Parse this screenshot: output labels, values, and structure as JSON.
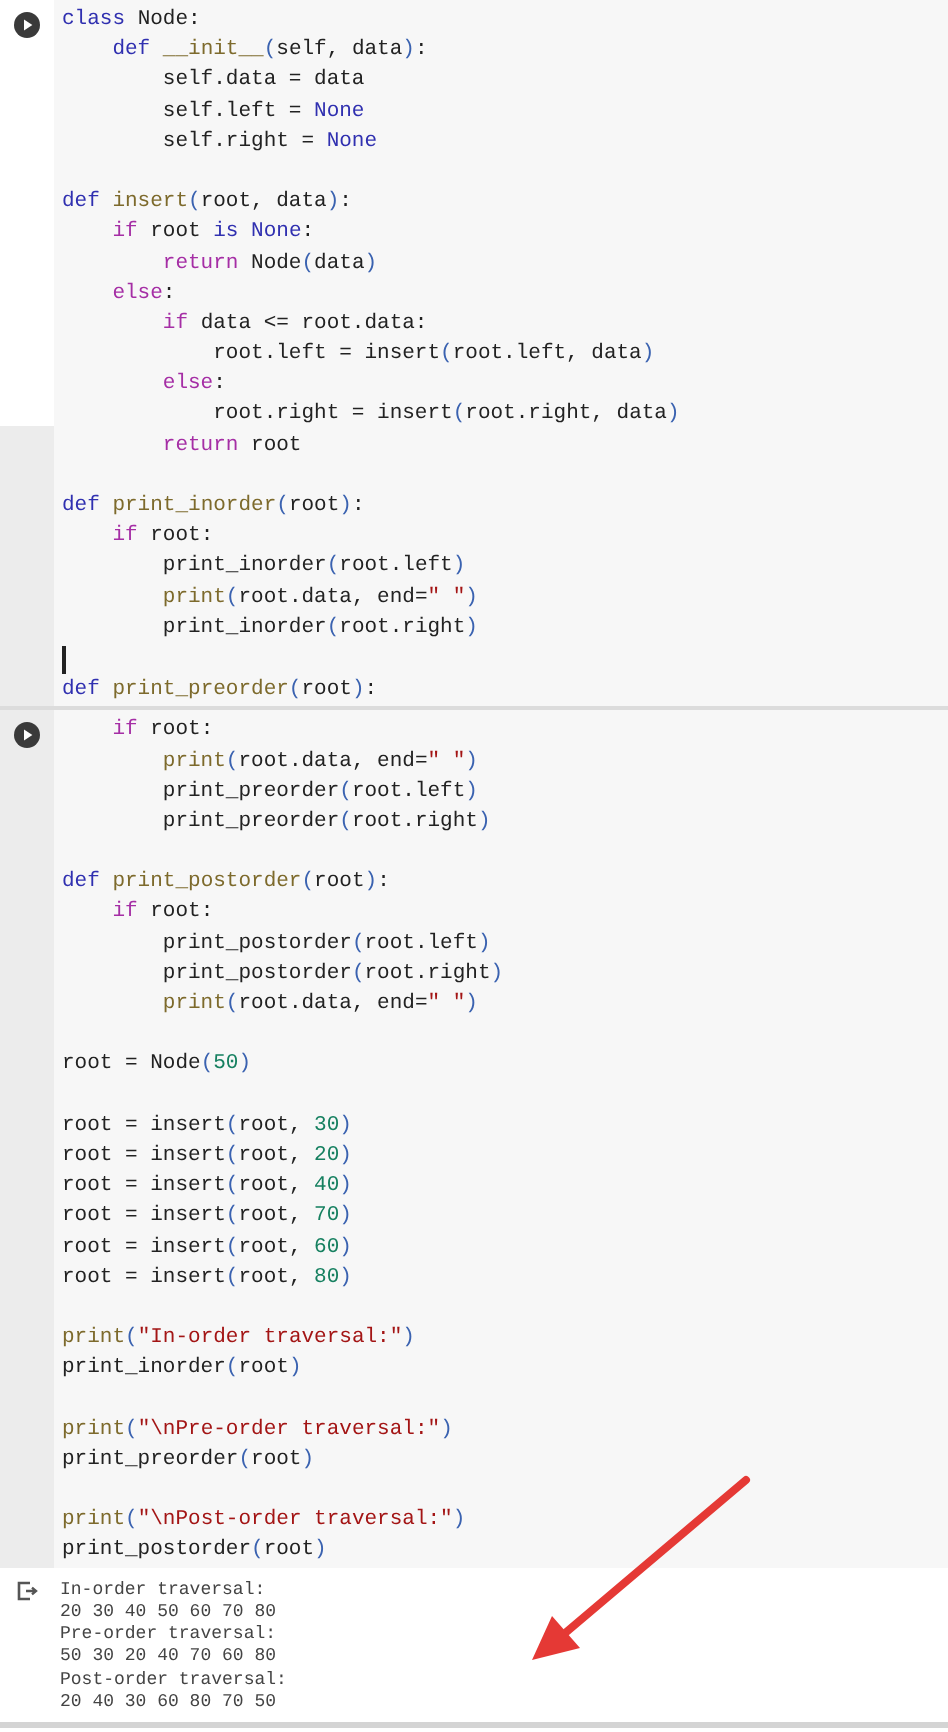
{
  "cells": [
    {
      "lines": [
        {
          "t": [
            {
              "text": "class",
              "kind": "kw"
            },
            {
              "text": " Node:",
              "kind": "txt"
            }
          ]
        },
        {
          "t": [
            {
              "text": "    def",
              "kind": "kw"
            },
            {
              "text": " __init__",
              "kind": "fn"
            },
            {
              "text": "(",
              "kind": "br"
            },
            {
              "text": "self, data",
              "kind": "txt"
            },
            {
              "text": ")",
              "kind": "br"
            },
            {
              "text": ":",
              "kind": "txt"
            }
          ]
        },
        {
          "t": [
            {
              "text": "        self.data = data",
              "kind": "txt"
            }
          ]
        },
        {
          "t": [
            {
              "text": "        self.left = ",
              "kind": "txt"
            },
            {
              "text": "None",
              "kind": "kw"
            }
          ]
        },
        {
          "t": [
            {
              "text": "        self.right = ",
              "kind": "txt"
            },
            {
              "text": "None",
              "kind": "kw"
            }
          ]
        },
        {
          "t": [
            {
              "text": "def",
              "kind": "kw"
            },
            {
              "text": " insert",
              "kind": "fn"
            },
            {
              "text": "(",
              "kind": "br"
            },
            {
              "text": "root, data",
              "kind": "txt"
            },
            {
              "text": ")",
              "kind": "br"
            },
            {
              "text": ":",
              "kind": "txt"
            }
          ],
          "space_before": true
        },
        {
          "t": [
            {
              "text": "    if",
              "kind": "ctl"
            },
            {
              "text": " root ",
              "kind": "txt"
            },
            {
              "text": "is",
              "kind": "kw"
            },
            {
              "text": " None",
              "kind": "kw"
            },
            {
              "text": ":",
              "kind": "txt"
            }
          ]
        },
        {
          "t": [
            {
              "text": "        return",
              "kind": "ctl"
            },
            {
              "text": " Node",
              "kind": "txt"
            },
            {
              "text": "(",
              "kind": "br"
            },
            {
              "text": "data",
              "kind": "txt"
            },
            {
              "text": ")",
              "kind": "br"
            }
          ]
        },
        {
          "t": [
            {
              "text": "    else",
              "kind": "ctl"
            },
            {
              "text": ":",
              "kind": "txt"
            }
          ]
        },
        {
          "t": [
            {
              "text": "        if",
              "kind": "ctl"
            },
            {
              "text": " data <= root.data:",
              "kind": "txt"
            }
          ]
        },
        {
          "t": [
            {
              "text": "            root.left = insert",
              "kind": "txt"
            },
            {
              "text": "(",
              "kind": "br"
            },
            {
              "text": "root.left, data",
              "kind": "txt"
            },
            {
              "text": ")",
              "kind": "br"
            }
          ]
        },
        {
          "t": [
            {
              "text": "        else",
              "kind": "ctl"
            },
            {
              "text": ":",
              "kind": "txt"
            }
          ]
        },
        {
          "t": [
            {
              "text": "            root.right = insert",
              "kind": "txt"
            },
            {
              "text": "(",
              "kind": "br"
            },
            {
              "text": "root.right, data",
              "kind": "txt"
            },
            {
              "text": ")",
              "kind": "br"
            }
          ]
        },
        {
          "t": [
            {
              "text": "        return",
              "kind": "ctl"
            },
            {
              "text": " root",
              "kind": "txt"
            }
          ]
        },
        {
          "t": [
            {
              "text": "def",
              "kind": "kw"
            },
            {
              "text": " print_inorder",
              "kind": "fn"
            },
            {
              "text": "(",
              "kind": "br"
            },
            {
              "text": "root",
              "kind": "txt"
            },
            {
              "text": ")",
              "kind": "br"
            },
            {
              "text": ":",
              "kind": "txt"
            }
          ],
          "space_before": true
        },
        {
          "t": [
            {
              "text": "    if",
              "kind": "ctl"
            },
            {
              "text": " root:",
              "kind": "txt"
            }
          ]
        },
        {
          "t": [
            {
              "text": "        print_inorder",
              "kind": "txt"
            },
            {
              "text": "(",
              "kind": "br"
            },
            {
              "text": "root.left",
              "kind": "txt"
            },
            {
              "text": ")",
              "kind": "br"
            }
          ]
        },
        {
          "t": [
            {
              "text": "        print",
              "kind": "fn"
            },
            {
              "text": "(",
              "kind": "br"
            },
            {
              "text": "root.data, end=",
              "kind": "txt"
            },
            {
              "text": "\" \"",
              "kind": "str"
            },
            {
              "text": ")",
              "kind": "br"
            }
          ]
        },
        {
          "t": [
            {
              "text": "        print_inorder",
              "kind": "txt"
            },
            {
              "text": "(",
              "kind": "br"
            },
            {
              "text": "root.right",
              "kind": "txt"
            },
            {
              "text": ")",
              "kind": "br"
            }
          ]
        },
        {
          "t": [
            {
              "text": "def",
              "kind": "kw"
            },
            {
              "text": " print_preorder",
              "kind": "fn"
            },
            {
              "text": "(",
              "kind": "br"
            },
            {
              "text": "root",
              "kind": "txt"
            },
            {
              "text": ")",
              "kind": "br"
            },
            {
              "text": ":",
              "kind": "txt"
            }
          ],
          "space_before": true,
          "cursor_in_gap": true
        }
      ]
    },
    {
      "lines": [
        {
          "t": [
            {
              "text": "    if",
              "kind": "ctl"
            },
            {
              "text": " root:",
              "kind": "txt"
            }
          ]
        },
        {
          "t": [
            {
              "text": "        print",
              "kind": "fn"
            },
            {
              "text": "(",
              "kind": "br"
            },
            {
              "text": "root.data, end=",
              "kind": "txt"
            },
            {
              "text": "\" \"",
              "kind": "str"
            },
            {
              "text": ")",
              "kind": "br"
            }
          ]
        },
        {
          "t": [
            {
              "text": "        print_preorder",
              "kind": "txt"
            },
            {
              "text": "(",
              "kind": "br"
            },
            {
              "text": "root.left",
              "kind": "txt"
            },
            {
              "text": ")",
              "kind": "br"
            }
          ]
        },
        {
          "t": [
            {
              "text": "        print_preorder",
              "kind": "txt"
            },
            {
              "text": "(",
              "kind": "br"
            },
            {
              "text": "root.right",
              "kind": "txt"
            },
            {
              "text": ")",
              "kind": "br"
            }
          ]
        },
        {
          "t": [
            {
              "text": "def",
              "kind": "kw"
            },
            {
              "text": " print_postorder",
              "kind": "fn"
            },
            {
              "text": "(",
              "kind": "br"
            },
            {
              "text": "root",
              "kind": "txt"
            },
            {
              "text": ")",
              "kind": "br"
            },
            {
              "text": ":",
              "kind": "txt"
            }
          ],
          "space_before": true
        },
        {
          "t": [
            {
              "text": "    if",
              "kind": "ctl"
            },
            {
              "text": " root:",
              "kind": "txt"
            }
          ]
        },
        {
          "t": [
            {
              "text": "        print_postorder",
              "kind": "txt"
            },
            {
              "text": "(",
              "kind": "br"
            },
            {
              "text": "root.left",
              "kind": "txt"
            },
            {
              "text": ")",
              "kind": "br"
            }
          ]
        },
        {
          "t": [
            {
              "text": "        print_postorder",
              "kind": "txt"
            },
            {
              "text": "(",
              "kind": "br"
            },
            {
              "text": "root.right",
              "kind": "txt"
            },
            {
              "text": ")",
              "kind": "br"
            }
          ]
        },
        {
          "t": [
            {
              "text": "        print",
              "kind": "fn"
            },
            {
              "text": "(",
              "kind": "br"
            },
            {
              "text": "root.data, end=",
              "kind": "txt"
            },
            {
              "text": "\" \"",
              "kind": "str"
            },
            {
              "text": ")",
              "kind": "br"
            }
          ]
        },
        {
          "t": [
            {
              "text": "root = Node",
              "kind": "txt"
            },
            {
              "text": "(",
              "kind": "br"
            },
            {
              "text": "50",
              "kind": "num"
            },
            {
              "text": ")",
              "kind": "br"
            }
          ],
          "space_before": true
        },
        {
          "t": [
            {
              "text": "root = insert",
              "kind": "txt"
            },
            {
              "text": "(",
              "kind": "br"
            },
            {
              "text": "root, ",
              "kind": "txt"
            },
            {
              "text": "30",
              "kind": "num"
            },
            {
              "text": ")",
              "kind": "br"
            }
          ],
          "space_before": true
        },
        {
          "t": [
            {
              "text": "root = insert",
              "kind": "txt"
            },
            {
              "text": "(",
              "kind": "br"
            },
            {
              "text": "root, ",
              "kind": "txt"
            },
            {
              "text": "20",
              "kind": "num"
            },
            {
              "text": ")",
              "kind": "br"
            }
          ]
        },
        {
          "t": [
            {
              "text": "root = insert",
              "kind": "txt"
            },
            {
              "text": "(",
              "kind": "br"
            },
            {
              "text": "root, ",
              "kind": "txt"
            },
            {
              "text": "40",
              "kind": "num"
            },
            {
              "text": ")",
              "kind": "br"
            }
          ]
        },
        {
          "t": [
            {
              "text": "root = insert",
              "kind": "txt"
            },
            {
              "text": "(",
              "kind": "br"
            },
            {
              "text": "root, ",
              "kind": "txt"
            },
            {
              "text": "70",
              "kind": "num"
            },
            {
              "text": ")",
              "kind": "br"
            }
          ]
        },
        {
          "t": [
            {
              "text": "root = insert",
              "kind": "txt"
            },
            {
              "text": "(",
              "kind": "br"
            },
            {
              "text": "root, ",
              "kind": "txt"
            },
            {
              "text": "60",
              "kind": "num"
            },
            {
              "text": ")",
              "kind": "br"
            }
          ]
        },
        {
          "t": [
            {
              "text": "root = insert",
              "kind": "txt"
            },
            {
              "text": "(",
              "kind": "br"
            },
            {
              "text": "root, ",
              "kind": "txt"
            },
            {
              "text": "80",
              "kind": "num"
            },
            {
              "text": ")",
              "kind": "br"
            }
          ]
        },
        {
          "t": [
            {
              "text": "print",
              "kind": "fn"
            },
            {
              "text": "(",
              "kind": "br"
            },
            {
              "text": "\"In-order traversal:\"",
              "kind": "str"
            },
            {
              "text": ")",
              "kind": "br"
            }
          ],
          "space_before": true
        },
        {
          "t": [
            {
              "text": "print_inorder",
              "kind": "txt"
            },
            {
              "text": "(",
              "kind": "br"
            },
            {
              "text": "root",
              "kind": "txt"
            },
            {
              "text": ")",
              "kind": "br"
            }
          ]
        },
        {
          "t": [
            {
              "text": "print",
              "kind": "fn"
            },
            {
              "text": "(",
              "kind": "br"
            },
            {
              "text": "\"\\nPre-order traversal:\"",
              "kind": "str"
            },
            {
              "text": ")",
              "kind": "br"
            }
          ],
          "space_before": true
        },
        {
          "t": [
            {
              "text": "print_preorder",
              "kind": "txt"
            },
            {
              "text": "(",
              "kind": "br"
            },
            {
              "text": "root",
              "kind": "txt"
            },
            {
              "text": ")",
              "kind": "br"
            }
          ]
        },
        {
          "t": [
            {
              "text": "print",
              "kind": "fn"
            },
            {
              "text": "(",
              "kind": "br"
            },
            {
              "text": "\"\\nPost-order traversal:\"",
              "kind": "str"
            },
            {
              "text": ")",
              "kind": "br"
            }
          ],
          "space_before": true
        },
        {
          "t": [
            {
              "text": "print_postorder",
              "kind": "txt"
            },
            {
              "text": "(",
              "kind": "br"
            },
            {
              "text": "root",
              "kind": "txt"
            },
            {
              "text": ")",
              "kind": "br"
            }
          ]
        }
      ]
    }
  ],
  "output": {
    "lines": [
      "In-order traversal:",
      "20 30 40 50 60 70 80",
      "Pre-order traversal:",
      "50 30 20 40 70 60 80",
      "Post-order traversal:",
      "20 40 30 60 80 70 50"
    ]
  }
}
